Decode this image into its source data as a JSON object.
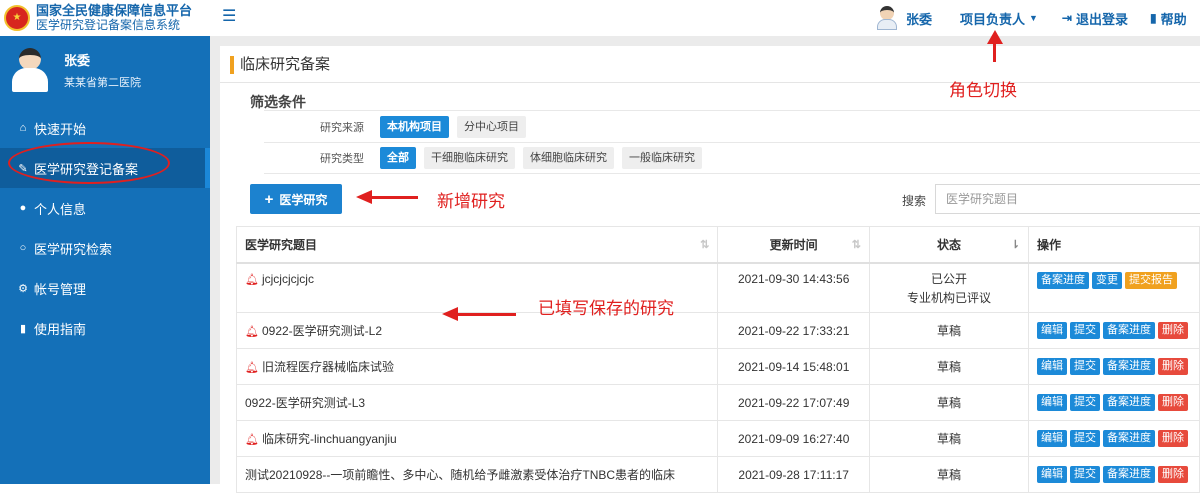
{
  "header": {
    "brand_title": "国家全民健康保障信息平台",
    "brand_subtitle": "医学研究登记备案信息系统",
    "user_name": "张委",
    "role_label": "项目负责人",
    "logout_label": "退出登录",
    "help_label": "帮助"
  },
  "sidebar": {
    "profile_name": "张委",
    "profile_org": "某某省第二医院",
    "items": [
      {
        "label": "快速开始"
      },
      {
        "label": "医学研究登记备案"
      },
      {
        "label": "个人信息"
      },
      {
        "label": "医学研究检索"
      },
      {
        "label": "帐号管理"
      },
      {
        "label": "使用指南"
      }
    ]
  },
  "main": {
    "title": "临床研究备案",
    "filter_heading": "筛选条件",
    "filters": [
      {
        "label": "研究来源",
        "options": [
          "本机构项目",
          "分中心项目"
        ],
        "selected": "本机构项目"
      },
      {
        "label": "研究类型",
        "options": [
          "全部",
          "干细胞临床研究",
          "体细胞临床研究",
          "一般临床研究"
        ],
        "selected": "全部"
      }
    ],
    "add_button": "医学研究",
    "search_label": "搜索",
    "search_placeholder": "医学研究题目",
    "columns": [
      "医学研究题目",
      "更新时间",
      "状态",
      "操作"
    ],
    "rows": [
      {
        "title": "jcjcjcjcjcjc",
        "bell": true,
        "time": "2021-09-30 14:43:56",
        "status": "已公开",
        "status2": "专业机构已评议",
        "actions": [
          "备案进度",
          "变更",
          "提交报告"
        ]
      },
      {
        "title": "0922-医学研究测试-L2",
        "bell": true,
        "time": "2021-09-22 17:33:21",
        "status": "草稿",
        "status2": "",
        "actions": [
          "编辑",
          "提交",
          "备案进度",
          "删除"
        ]
      },
      {
        "title": "旧流程医疗器械临床试验",
        "bell": true,
        "time": "2021-09-14 15:48:01",
        "status": "草稿",
        "status2": "",
        "actions": [
          "编辑",
          "提交",
          "备案进度",
          "删除"
        ]
      },
      {
        "title": "0922-医学研究测试-L3",
        "bell": false,
        "time": "2021-09-22 17:07:49",
        "status": "草稿",
        "status2": "",
        "actions": [
          "编辑",
          "提交",
          "备案进度",
          "删除"
        ]
      },
      {
        "title": "临床研究-linchuangyanjiu",
        "bell": true,
        "time": "2021-09-09 16:27:40",
        "status": "草稿",
        "status2": "",
        "actions": [
          "编辑",
          "提交",
          "备案进度",
          "删除"
        ]
      },
      {
        "title": "测试20210928--一项前瞻性、多中心、随机给予雌激素受体治疗TNBC患者的临床",
        "bell": false,
        "time": "2021-09-28 17:11:17",
        "status": "草稿",
        "status2": "",
        "actions": [
          "编辑",
          "提交",
          "备案进度",
          "删除"
        ]
      }
    ]
  },
  "annotations": {
    "role_switch": "角色切换",
    "new_study": "新增研究",
    "saved_studies": "已填写保存的研究"
  },
  "colors": {
    "sidebar": "#1470b8",
    "accent": "#1c8ad8",
    "annotation": "#e0201f",
    "warning": "#f0a11f",
    "danger": "#e74a3c"
  }
}
